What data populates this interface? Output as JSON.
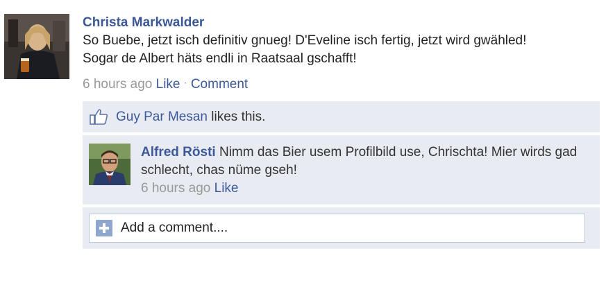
{
  "post": {
    "author": "Christa Markwalder",
    "text_line1": "So Buebe, jetzt isch definitiv gnueg! D'Eveline isch fertig, jetzt wird gwähled!",
    "text_line2": "Sogar de Albert häts endli in Raatsaal gschafft!",
    "time": "6 hours ago",
    "like_label": "Like",
    "separator": "·",
    "comment_label": "Comment"
  },
  "likes": {
    "icon": "thumbs-up-icon",
    "liker": "Guy Par Mesan",
    "suffix": " likes this."
  },
  "comment": {
    "author": "Alfred Rösti",
    "text": "Nimm das Bier usem Profilbild use, Chrischta! Mier wirds gad schlecht, chas nüme gseh!",
    "time": "6 hours ago",
    "like_label": "Like"
  },
  "add_comment": {
    "icon": "plus-icon",
    "placeholder": "Add a comment...."
  },
  "colors": {
    "link": "#3b5998",
    "meta": "#999999",
    "panel": "#e9ebf2"
  }
}
